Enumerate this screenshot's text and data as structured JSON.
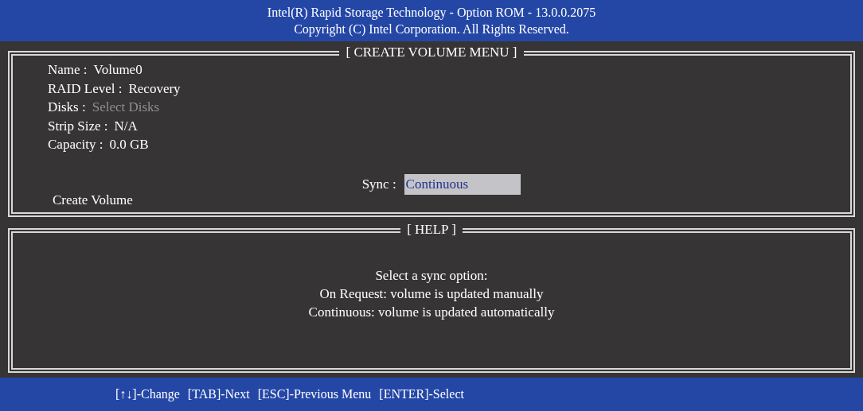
{
  "header": {
    "title": "Intel(R) Rapid Storage Technology - Option ROM - 13.0.0.2075",
    "copyright": "Copyright (C)  Intel Corporation.   All Rights Reserved."
  },
  "create_volume_menu": {
    "title": "[ CREATE VOLUME MENU ]",
    "fields": [
      {
        "label": "Name :",
        "value": "Volume0",
        "disabled": false
      },
      {
        "label": "RAID Level :",
        "value": "Recovery",
        "disabled": false
      },
      {
        "label": "Disks :",
        "value": "Select Disks",
        "disabled": true
      },
      {
        "label": "Strip Size :",
        "value": "N/A",
        "disabled": false
      },
      {
        "label": "Capacity :",
        "value": "0.0 GB",
        "disabled": false
      }
    ],
    "sync": {
      "label": "Sync :",
      "value": "Continuous",
      "selected": true
    },
    "create_button": "Create Volume"
  },
  "help": {
    "title": "[ HELP ]",
    "lines": [
      "Select a sync option:",
      "On Request: volume is updated manually",
      "Continuous: volume is updated automatically"
    ]
  },
  "footer": {
    "hints": [
      "[↑↓]-Change",
      "[TAB]-Next",
      "[ESC]-Previous Menu",
      "[ENTER]-Select"
    ]
  }
}
